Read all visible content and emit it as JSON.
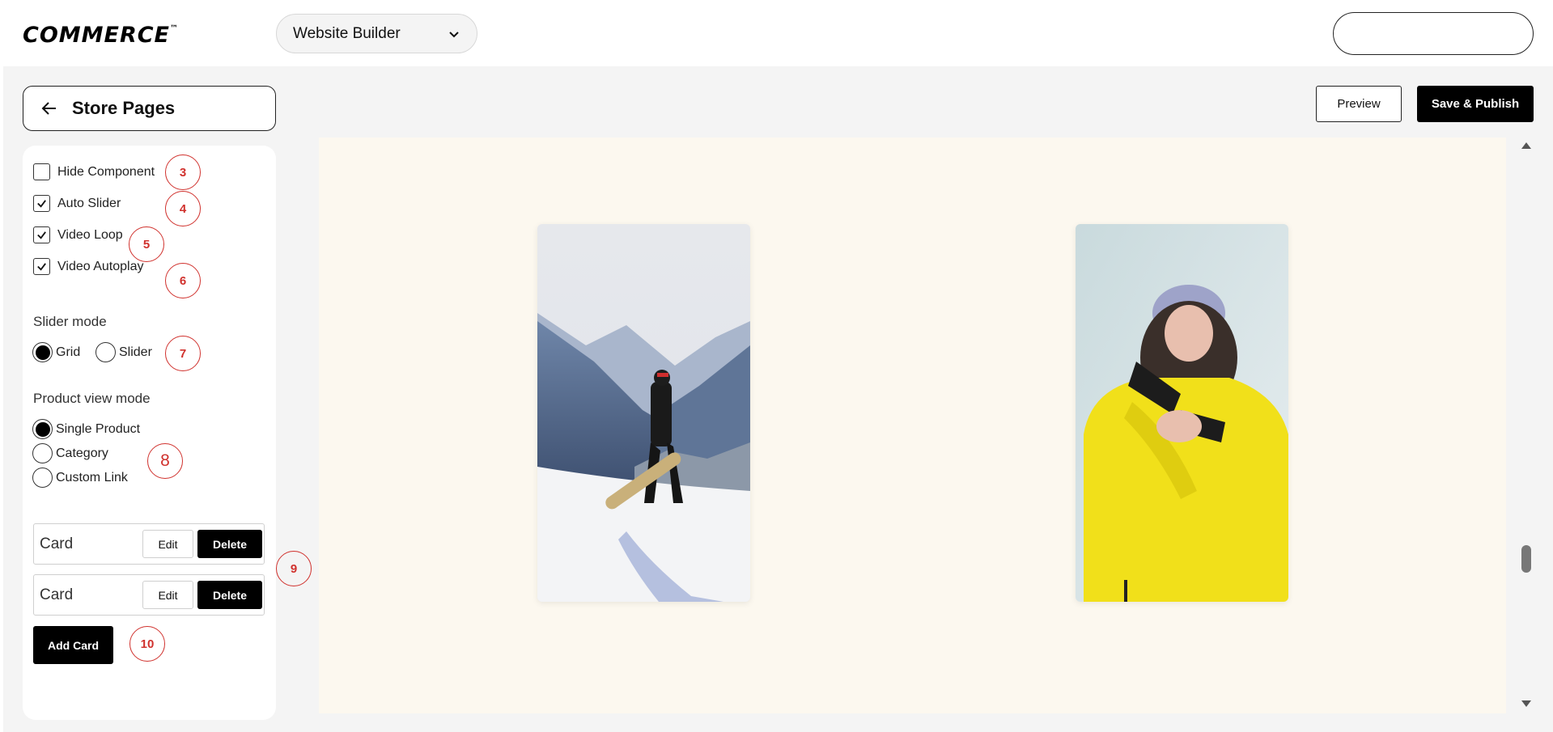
{
  "header": {
    "logo_text": "COMMERCE",
    "logo_tm": "™",
    "builder_select_value": "Website Builder"
  },
  "toolbar": {
    "back_label": "Store Pages",
    "preview_label": "Preview",
    "publish_label": "Save & Publish"
  },
  "panel": {
    "checkboxes": [
      {
        "label": "Hide Component",
        "checked": false
      },
      {
        "label": "Auto Slider",
        "checked": true
      },
      {
        "label": "Video Loop",
        "checked": true
      },
      {
        "label": "Video Autoplay",
        "checked": true
      }
    ],
    "slider_mode": {
      "label": "Slider mode",
      "options": [
        {
          "label": "Grid",
          "selected": true
        },
        {
          "label": "Slider",
          "selected": false
        }
      ]
    },
    "product_view_mode": {
      "label": "Product view mode",
      "options": [
        {
          "label": "Single Product",
          "selected": true
        },
        {
          "label": "Category",
          "selected": false
        },
        {
          "label": "Custom Link",
          "selected": false
        }
      ]
    },
    "cards": [
      {
        "label": "Card",
        "edit_label": "Edit",
        "delete_label": "Delete"
      },
      {
        "label": "Card",
        "edit_label": "Edit",
        "delete_label": "Delete"
      }
    ],
    "add_card_label": "Add Card"
  },
  "annotations": [
    "3",
    "4",
    "5",
    "6",
    "7",
    "8",
    "9",
    "10"
  ],
  "canvas": {
    "images": [
      {
        "name": "snowboarder-on-slope-image"
      },
      {
        "name": "person-in-yellow-jacket-image"
      }
    ]
  },
  "colors": {
    "canvas_bg": "#fcf8ef",
    "workspace_bg": "#f4f4f4",
    "annotation": "#d0312d",
    "primary_button": "#000000"
  }
}
